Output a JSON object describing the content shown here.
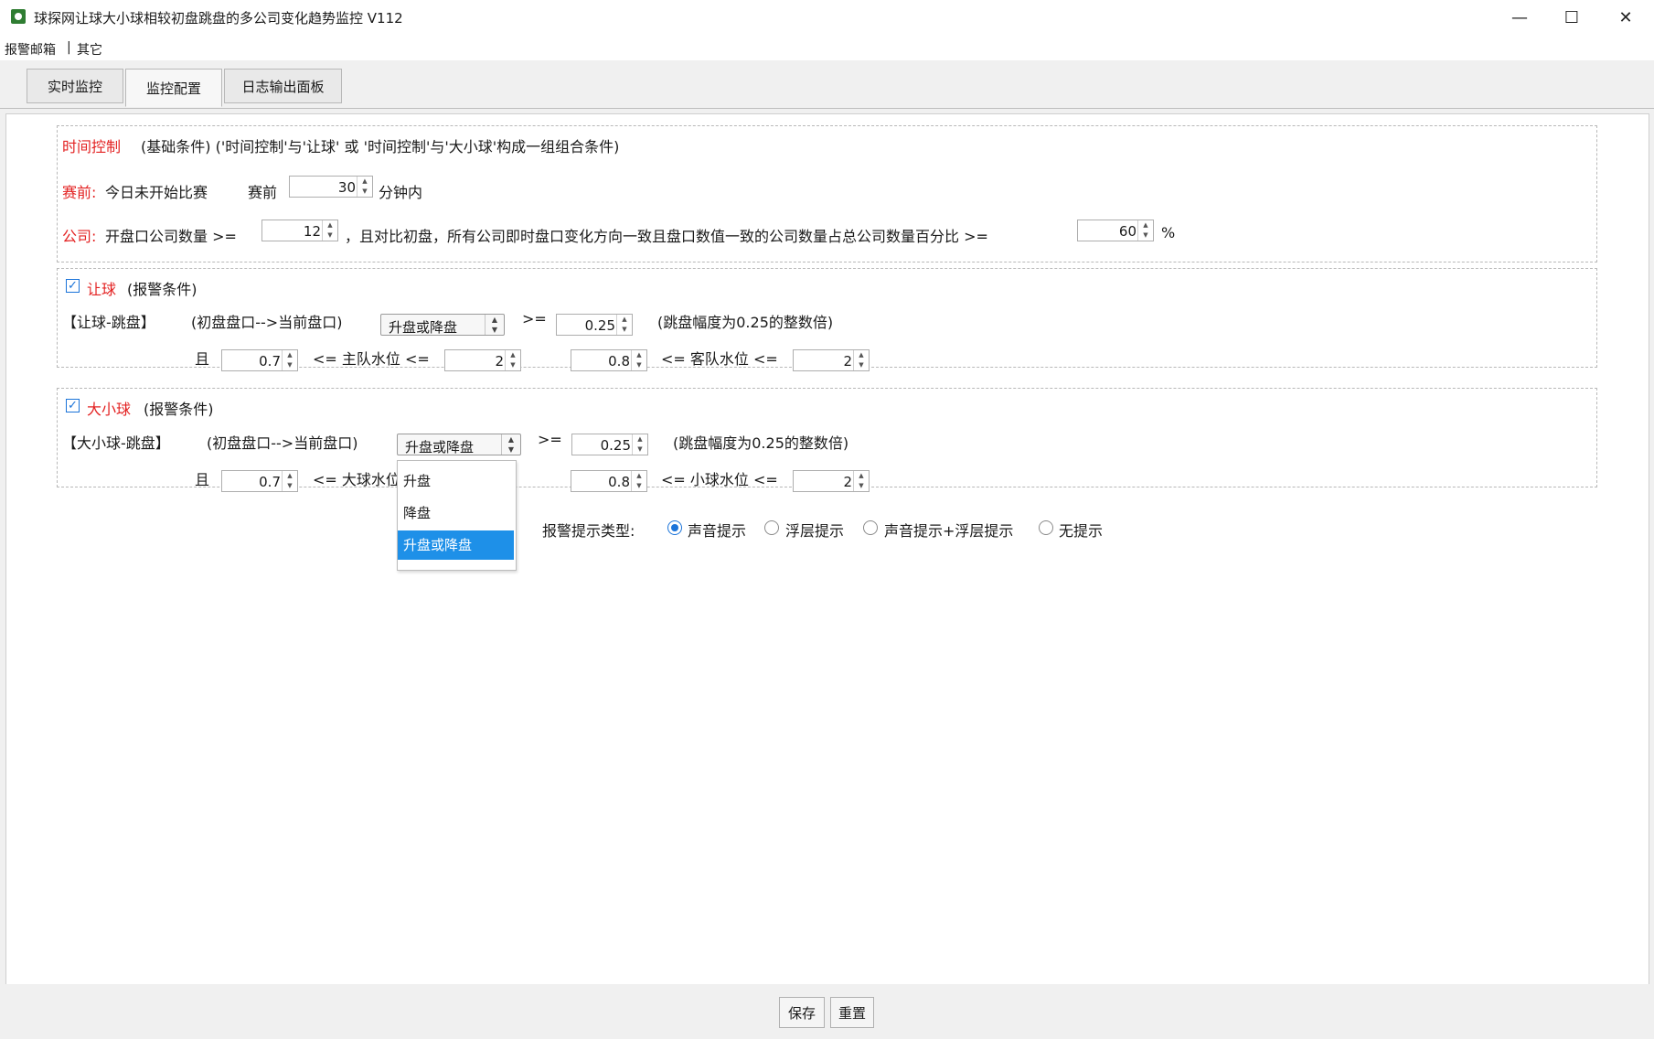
{
  "window": {
    "title": "球探网让球大小球相较初盘跳盘的多公司变化趋势监控 V112",
    "minimize": "—",
    "maximize": "☐",
    "close": "✕"
  },
  "menu": {
    "item1": "报警邮箱",
    "separator": "|",
    "item2": "其它"
  },
  "tabs": [
    {
      "label": "实时监控"
    },
    {
      "label": "监控配置"
    },
    {
      "label": "日志输出面板"
    }
  ],
  "time_control": {
    "heading": "时间控制",
    "desc": "(基础条件) ('时间控制'与'让球' 或 '时间控制'与'大小球'构成一组组合条件)",
    "pre_label": "赛前:",
    "pre_text": "今日未开始比赛",
    "pre_before": "赛前",
    "pre_minutes": "30",
    "pre_unit": "分钟内",
    "company_label": "公司:",
    "company_text": "开盘口公司数量 >=",
    "company_count": "12",
    "company_text2": "，且对比初盘，所有公司即时盘口变化方向一致且盘口数值一致的公司数量占总公司数量百分比 >=",
    "company_percent": "60",
    "percent_sign": "%"
  },
  "handicap": {
    "check": "✓",
    "title": "让球",
    "subtitle": "(报警条件)",
    "row_label": "【让球-跳盘】",
    "flow": "(初盘盘口-->当前盘口)",
    "direction": "升盘或降盘",
    "gte": ">=",
    "jump": "0.25",
    "note": "(跳盘幅度为0.25的整数倍)",
    "and": "且",
    "home_min": "0.7",
    "home_label": "<= 主队水位 <=",
    "home_max": "2",
    "away_min": "0.8",
    "away_label": "<= 客队水位 <=",
    "away_max": "2"
  },
  "overunder": {
    "check": "✓",
    "title": "大小球",
    "subtitle": "(报警条件)",
    "row_label": "【大小球-跳盘】",
    "flow": "(初盘盘口-->当前盘口)",
    "direction": "升盘或降盘",
    "gte": ">=",
    "jump": "0.25",
    "note": "(跳盘幅度为0.25的整数倍)",
    "and": "且",
    "over_min": "0.7",
    "over_label": "<= 大球水位",
    "under_min": "0.8",
    "under_label": "<= 小球水位 <=",
    "under_max": "2"
  },
  "dropdown": {
    "options": [
      "升盘",
      "降盘",
      "升盘或降盘"
    ],
    "selected": "升盘或降盘"
  },
  "alert": {
    "label": "报警提示类型:",
    "options": [
      "声音提示",
      "浮层提示",
      "声音提示+浮层提示",
      "无提示"
    ],
    "selected": "声音提示"
  },
  "footer": {
    "save": "保存",
    "reset": "重置"
  },
  "colors": {
    "accent": "#1a73d9",
    "highlight": "#e32222",
    "selection": "#1e90e8"
  }
}
